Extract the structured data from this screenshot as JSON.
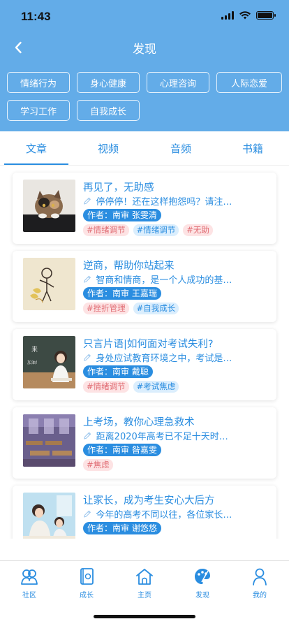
{
  "status": {
    "time": "11:43"
  },
  "nav": {
    "title": "发现"
  },
  "categories": [
    "情绪行为",
    "身心健康",
    "心理咨询",
    "人际恋爱",
    "学习工作",
    "自我成长"
  ],
  "tabs": [
    "文章",
    "视频",
    "音频",
    "书籍"
  ],
  "active_tab": "文章",
  "articles": [
    {
      "title": "再见了，无助感",
      "summary": "停停停！还在这样抱怨吗？请注意...",
      "author": "作者：南审 张雯清",
      "tags": [
        {
          "text": "#情绪调节",
          "color": "red"
        },
        {
          "text": "#情绪调节",
          "color": "blue"
        },
        {
          "text": "#无助",
          "color": "red"
        }
      ]
    },
    {
      "title": "逆商，帮助你站起来",
      "summary": "智商和情商，是一个人成功的基石...",
      "author": "作者：南审 王嘉瑞",
      "tags": [
        {
          "text": "#挫折管理",
          "color": "red"
        },
        {
          "text": "#自我成长",
          "color": "blue"
        }
      ]
    },
    {
      "title": "只言片语|如何面对考试失利?",
      "summary": "身处应试教育环境之中，考试是学...",
      "author": "作者：南审 戴聪",
      "tags": [
        {
          "text": "#情绪调节",
          "color": "red"
        },
        {
          "text": "#考试焦虑",
          "color": "blue"
        }
      ]
    },
    {
      "title": "上考场，教你心理急救术",
      "summary": "距离2020年高考已不足十天时间...",
      "author": "作者：南审 昝嘉雯",
      "tags": [
        {
          "text": "#焦虑",
          "color": "red"
        }
      ]
    },
    {
      "title": "让家长，成为考生安心大后方",
      "summary": "今年的高考不同以往，各位家长陪...",
      "author": "作者：南审 谢悠悠",
      "tags": []
    }
  ],
  "bottom_nav": [
    "社区",
    "成长",
    "主页",
    "发现",
    "我的"
  ],
  "colors": {
    "header_blue": "#63ACE8",
    "accent_blue": "#2a8de0",
    "tag_red_bg": "#fde3e4",
    "tag_red_text": "#e06c73",
    "tag_blue_bg": "#dbeefd"
  }
}
